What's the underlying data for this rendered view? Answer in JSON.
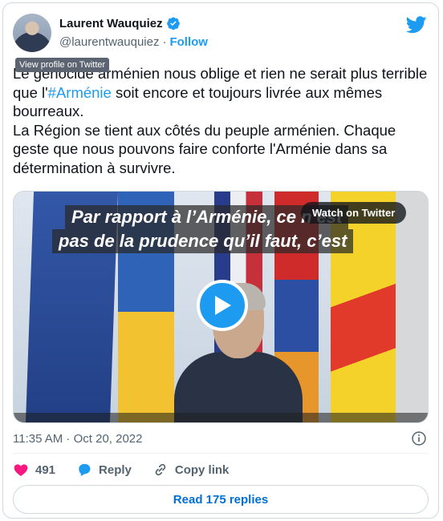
{
  "header": {
    "name": "Laurent Wauquiez",
    "handle": "@laurentwauquiez",
    "separator": "·",
    "follow_label": "Follow",
    "tooltip": "View profile on Twitter"
  },
  "tweet": {
    "text_before": "Le génocide arménien nous oblige et rien ne serait plus terrible que l'",
    "hashtag": "#Arménie",
    "text_after": " soit encore et toujours livrée aux mêmes bourreaux.\nLa Région se tient aux côtés du peuple arménien. Chaque geste que nous pouvons faire conforte l'Arménie dans sa détermination à survivre."
  },
  "media": {
    "caption_line1": "Par rapport à l’Arménie, ce n’est",
    "caption_line2": "pas de la prudence qu’il faut, c’est",
    "watch_label": "Watch on Twitter"
  },
  "meta": {
    "timestamp": "11:35 AM · Oct 20, 2022"
  },
  "actions": {
    "likes": "491",
    "reply_label": "Reply",
    "copy_label": "Copy link"
  },
  "replies_button": "Read 175 replies",
  "colors": {
    "accent": "#1d9bf0",
    "like": "#f91880",
    "link": "#006fd6"
  },
  "icons": [
    "verified-icon",
    "twitter-logo-icon",
    "play-icon",
    "info-icon",
    "heart-icon",
    "reply-icon",
    "link-icon"
  ]
}
